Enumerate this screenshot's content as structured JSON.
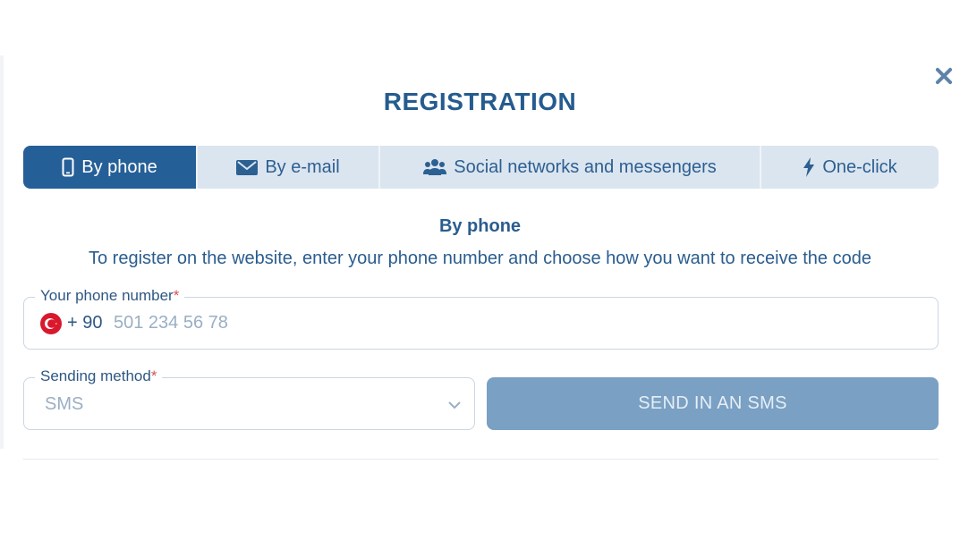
{
  "modal": {
    "title": "REGISTRATION",
    "close_icon": "close-icon"
  },
  "tabs": [
    {
      "label": "By phone",
      "icon": "phone-icon",
      "active": true
    },
    {
      "label": "By e-mail",
      "icon": "envelope-icon",
      "active": false
    },
    {
      "label": "Social networks and messengers",
      "icon": "users-icon",
      "active": false
    },
    {
      "label": "One-click",
      "icon": "lightning-icon",
      "active": false
    }
  ],
  "section": {
    "title": "By phone",
    "description": "To register on the website, enter your phone number and choose how you want to receive the code"
  },
  "phone_field": {
    "label": "Your phone number",
    "required_mark": "*",
    "country_flag": "turkey-flag-icon",
    "prefix": "+ 90",
    "placeholder": "501 234 56 78",
    "value": ""
  },
  "method_field": {
    "label": "Sending method",
    "required_mark": "*",
    "selected": "SMS"
  },
  "send_button": {
    "label": "SEND IN AN SMS"
  },
  "colors": {
    "primary": "#255f98",
    "tab_bg": "#dbe5ef",
    "button_disabled": "#7aa0c3",
    "text": "#2a5d8e",
    "required": "#d9534f",
    "flag": "#d9182d"
  }
}
